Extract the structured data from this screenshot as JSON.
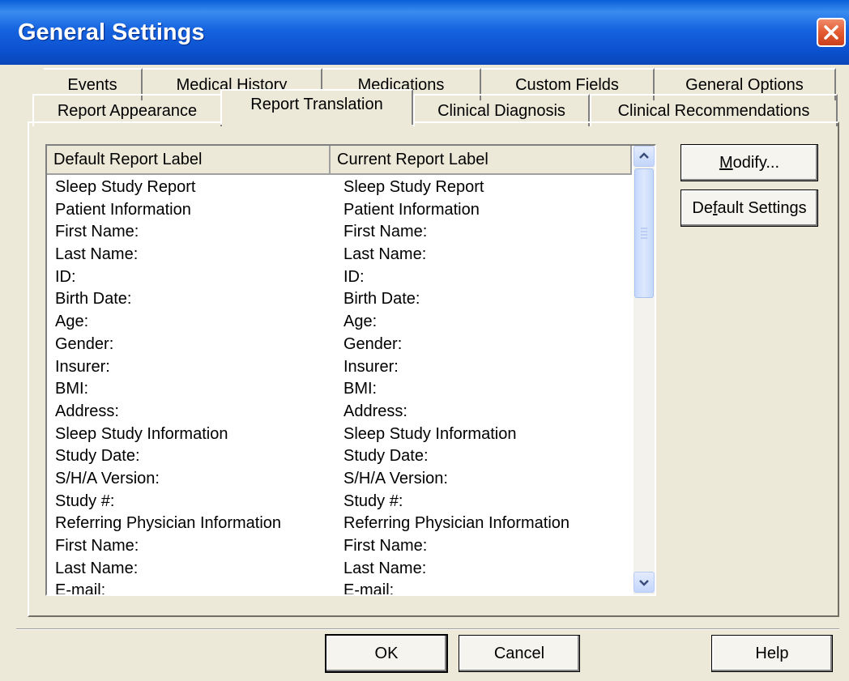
{
  "window": {
    "title": "General Settings"
  },
  "tabs_back": [
    "Events",
    "Medical History",
    "Medications",
    "Custom Fields",
    "General Options"
  ],
  "tabs_front": [
    "Report Appearance",
    "Report Translation",
    "Clinical Diagnosis",
    "Clinical Recommendations"
  ],
  "active_tab": "Report Translation",
  "table": {
    "columns": [
      "Default Report Label",
      "Current Report Label"
    ],
    "rows": [
      [
        "Sleep Study Report",
        "Sleep Study Report"
      ],
      [
        "Patient Information",
        "Patient Information"
      ],
      [
        "First Name:",
        "First Name:"
      ],
      [
        "Last Name:",
        "Last Name:"
      ],
      [
        "ID:",
        "ID:"
      ],
      [
        "Birth Date:",
        "Birth Date:"
      ],
      [
        "Age:",
        "Age:"
      ],
      [
        "Gender:",
        "Gender:"
      ],
      [
        "Insurer:",
        "Insurer:"
      ],
      [
        "BMI:",
        "BMI:"
      ],
      [
        "Address:",
        "Address:"
      ],
      [
        "Sleep Study Information",
        "Sleep Study Information"
      ],
      [
        "Study Date:",
        "Study Date:"
      ],
      [
        "S/H/A Version:",
        "S/H/A Version:"
      ],
      [
        "Study #:",
        "Study #:"
      ],
      [
        "Referring Physician Information",
        "Referring Physician Information"
      ],
      [
        "First Name:",
        "First Name:"
      ],
      [
        "Last Name:",
        "Last Name:"
      ],
      [
        "E-mail:",
        "E-mail:"
      ]
    ]
  },
  "buttons": {
    "modify": {
      "pre": "",
      "u": "M",
      "post": "odify..."
    },
    "default_settings": {
      "pre": "De",
      "u": "f",
      "post": "ault Settings"
    },
    "ok": "OK",
    "cancel": "Cancel",
    "help": "Help"
  },
  "icons": {
    "close": "close-icon",
    "scroll_up": "chevron-up-icon",
    "scroll_down": "chevron-down-icon"
  }
}
